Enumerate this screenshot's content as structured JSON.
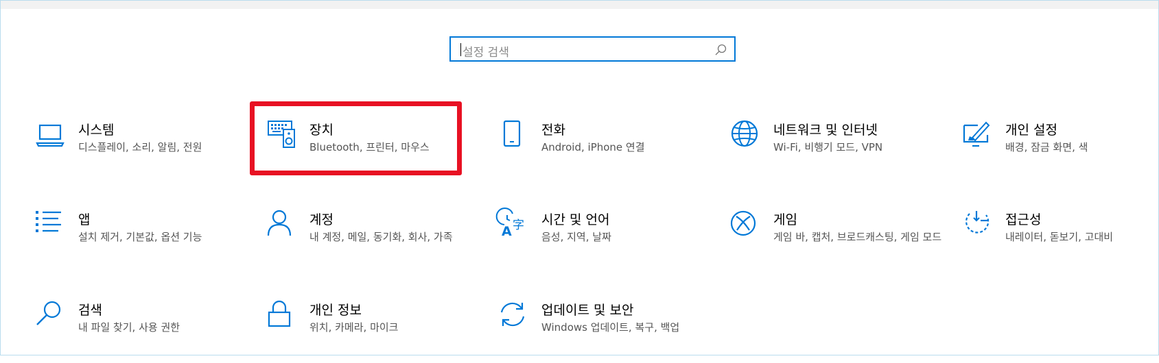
{
  "search": {
    "placeholder": "설정 검색"
  },
  "tiles": [
    {
      "title": "시스템",
      "desc": "디스플레이, 소리, 알림, 전원"
    },
    {
      "title": "장치",
      "desc": "Bluetooth, 프린터, 마우스"
    },
    {
      "title": "전화",
      "desc": "Android, iPhone 연결"
    },
    {
      "title": "네트워크 및 인터넷",
      "desc": "Wi-Fi, 비행기 모드, VPN"
    },
    {
      "title": "개인 설정",
      "desc": "배경, 잠금 화면, 색"
    },
    {
      "title": "앱",
      "desc": "설치 제거, 기본값, 옵션 기능"
    },
    {
      "title": "계정",
      "desc": "내 계정, 메일, 동기화, 회사, 가족"
    },
    {
      "title": "시간 및 언어",
      "desc": "음성, 지역, 날짜"
    },
    {
      "title": "게임",
      "desc": "게임 바, 캡처, 브로드캐스팅, 게임 모드"
    },
    {
      "title": "접근성",
      "desc": "내레이터, 돋보기, 고대비"
    },
    {
      "title": "검색",
      "desc": "내 파일 찾기, 사용 권한"
    },
    {
      "title": "개인 정보",
      "desc": "위치, 카메라, 마이크"
    },
    {
      "title": "업데이트 및 보안",
      "desc": "Windows 업데이트, 복구, 백업"
    }
  ],
  "icons": [
    "laptop-icon",
    "keyboard-speaker-icon",
    "phone-icon",
    "globe-icon",
    "personalization-icon",
    "apps-list-icon",
    "person-icon",
    "time-language-icon",
    "xbox-icon",
    "accessibility-icon",
    "search-icon",
    "lock-icon",
    "update-sync-icon"
  ],
  "colors": {
    "accent": "#0078d7",
    "highlight": "#e81123"
  }
}
